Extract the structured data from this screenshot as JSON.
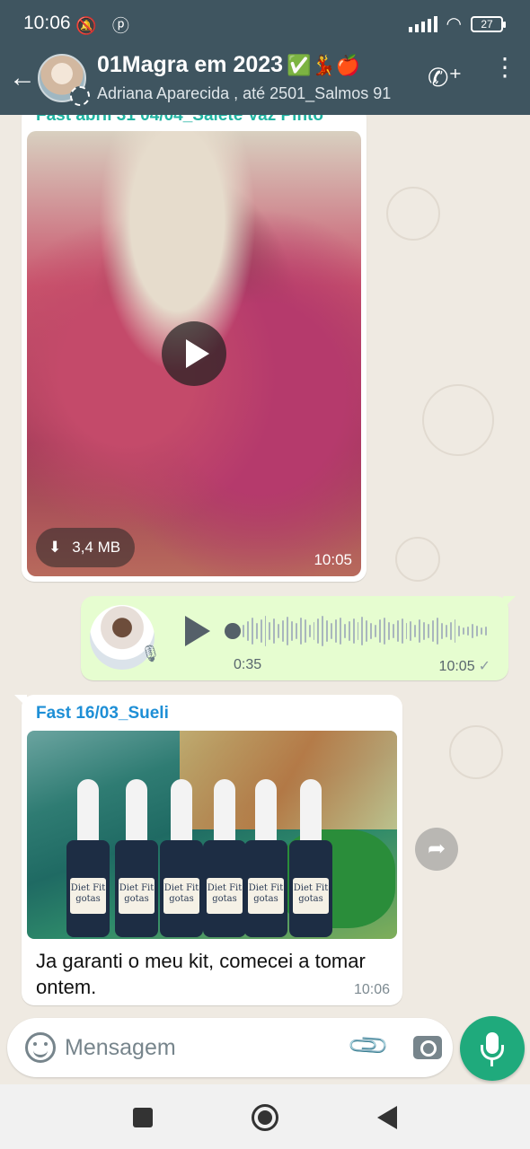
{
  "status_bar": {
    "time": "10:06",
    "icons": "🔕 ⓟ",
    "battery": "27"
  },
  "header": {
    "title": "01Magra em 2023",
    "title_emojis": "✅💃🍎",
    "subtitle": "Adriana Aparecida , até 2501_Salmos 91"
  },
  "messages": {
    "video": {
      "sender": "Fast abril 31 04/04_Salete Vaz Pinto",
      "download_size": "3,4 MB",
      "time": "10:05"
    },
    "voice": {
      "duration": "0:35",
      "time": "10:05"
    },
    "image": {
      "sender": "Fast 16/03_Sueli",
      "caption": "Ja garanti o meu kit, comecei a tomar ontem.",
      "time": "10:06",
      "bottle_label": "Diet Fit gotas"
    }
  },
  "composer": {
    "placeholder": "Mensagem"
  },
  "colors": {
    "header_bg": "#3f5560",
    "outgoing_bubble": "#e6fdd0",
    "accent_green": "#1faa7c",
    "sender_blue": "#1e8fd6"
  }
}
